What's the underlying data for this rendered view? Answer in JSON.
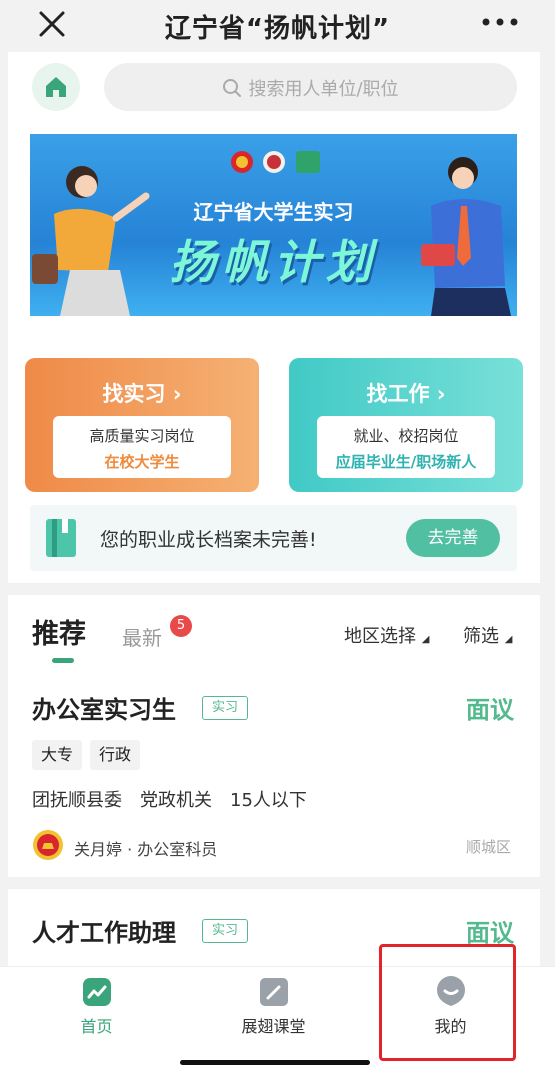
{
  "titlebar": {
    "title": "辽宁省“扬帆计划”",
    "close_icon": "close-icon",
    "more_icon": "more-icon"
  },
  "search": {
    "placeholder": "搜索用人单位/职位"
  },
  "banner": {
    "subtitle": "辽宁省大学生实习",
    "main_title": "扬帆计划"
  },
  "cards": {
    "intern": {
      "title": "找实习 ›",
      "line1": "高质量实习岗位",
      "line2": "在校大学生",
      "accent": "#f08a3c"
    },
    "job": {
      "title": "找工作 ›",
      "line1": "就业、校招岗位",
      "line2": "应届毕业生/职场新人",
      "accent": "#2fb2b0"
    }
  },
  "profile": {
    "text": "您的职业成长档案未完善!",
    "button": "去完善"
  },
  "tabs": {
    "recommend": "推荐",
    "latest": "最新",
    "latest_count": "5",
    "region": "地区选择",
    "filter": "筛选"
  },
  "jobs": [
    {
      "title": "办公室实习生",
      "tag": "实习",
      "salary": "面议",
      "chips": [
        "大专",
        "行政"
      ],
      "meta": [
        "团抚顺县委",
        "党政机关",
        "15人以下"
      ],
      "recruiter": "关月婷 · 办公室科员",
      "district": "顺城区"
    },
    {
      "title": "人才工作助理",
      "tag": "实习",
      "salary": "面议"
    }
  ],
  "nav": [
    {
      "label": "首页",
      "icon": "chart-icon",
      "active": true
    },
    {
      "label": "展翅课堂",
      "icon": "book-icon",
      "active": false
    },
    {
      "label": "我的",
      "icon": "profile-icon",
      "active": false
    }
  ],
  "colors": {
    "brand_green": "#3aa57a",
    "highlight_red": "#e3242b"
  }
}
